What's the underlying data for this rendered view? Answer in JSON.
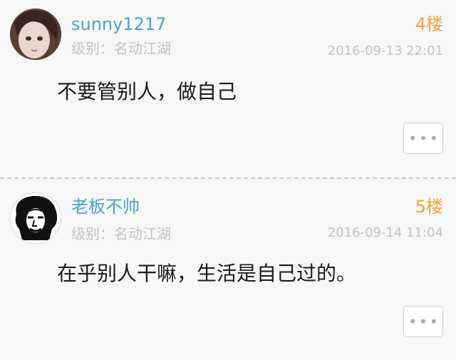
{
  "posts": [
    {
      "username": "sunny1217",
      "level_label": "级别：",
      "level_value": "名动江湖",
      "floor": "4楼",
      "timestamp": "2016-09-13 22:01",
      "content": "不要管别人，做自己",
      "more_icon": "ellipsis-icon"
    },
    {
      "username": "老板不帅",
      "level_label": "级别：",
      "level_value": "名动江湖",
      "floor": "5楼",
      "timestamp": "2016-09-14 11:04",
      "content": "在乎别人干嘛，生活是自己过的。",
      "more_icon": "ellipsis-icon"
    }
  ],
  "colors": {
    "username": "#4aa3c7",
    "floor": "#f0a33c",
    "meta": "#c4c4c4",
    "content": "#1a1a1a"
  }
}
